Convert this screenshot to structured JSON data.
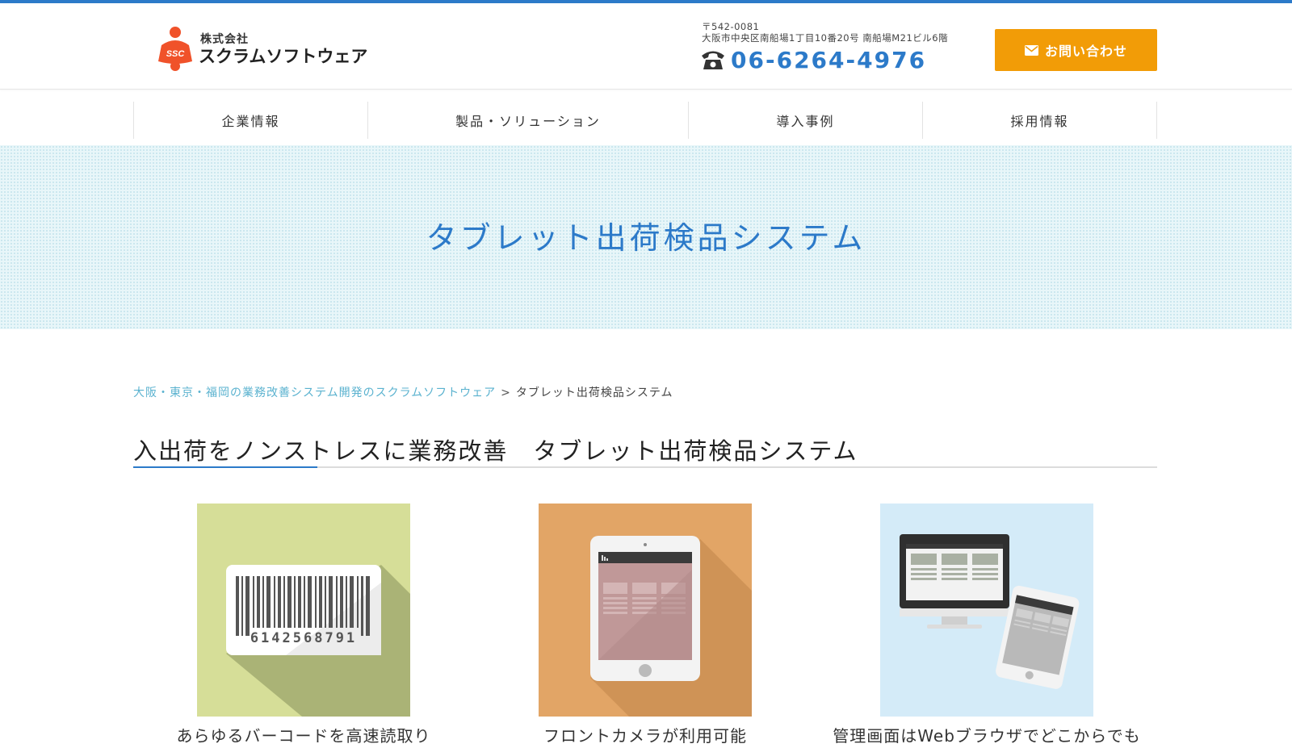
{
  "header": {
    "logo": {
      "company_type": "株式会社",
      "company_name": "スクラムソフトウェア",
      "mark_text": "SSC"
    },
    "address": {
      "postal": "〒542-0081",
      "line": "大阪市中央区南船場1丁目10番20号 南船場M21ビル6階"
    },
    "tel": "06-6264-4976",
    "contact_button": "お問い合わせ"
  },
  "nav": {
    "items": [
      {
        "label": "企業情報"
      },
      {
        "label": "製品・ソリューション"
      },
      {
        "label": "導入事例"
      },
      {
        "label": "採用情報"
      }
    ]
  },
  "hero": {
    "title": "タブレット出荷検品システム"
  },
  "breadcrumb": {
    "home": "大阪・東京・福岡の業務改善システム開発のスクラムソフトウェア",
    "separator": ">",
    "current": "タブレット出荷検品システム"
  },
  "section": {
    "title": "入出荷をノンストレスに業務改善　タブレット出荷検品システム"
  },
  "features": [
    {
      "caption": "あらゆるバーコードを高速読取り",
      "barcode_number": "6142568791",
      "icon": "barcode-icon",
      "bg": "#d6de98"
    },
    {
      "caption": "フロントカメラが利用可能",
      "icon": "tablet-icon",
      "bg": "#e2a566"
    },
    {
      "caption": "管理画面はWebブラウザでどこからでも",
      "icon": "monitor-tablet-icon",
      "bg": "#d4ebf8"
    }
  ],
  "colors": {
    "accent": "#2c7ac9",
    "button": "#f29c07",
    "link": "#5ab2cf",
    "logo": "#f0522a"
  }
}
